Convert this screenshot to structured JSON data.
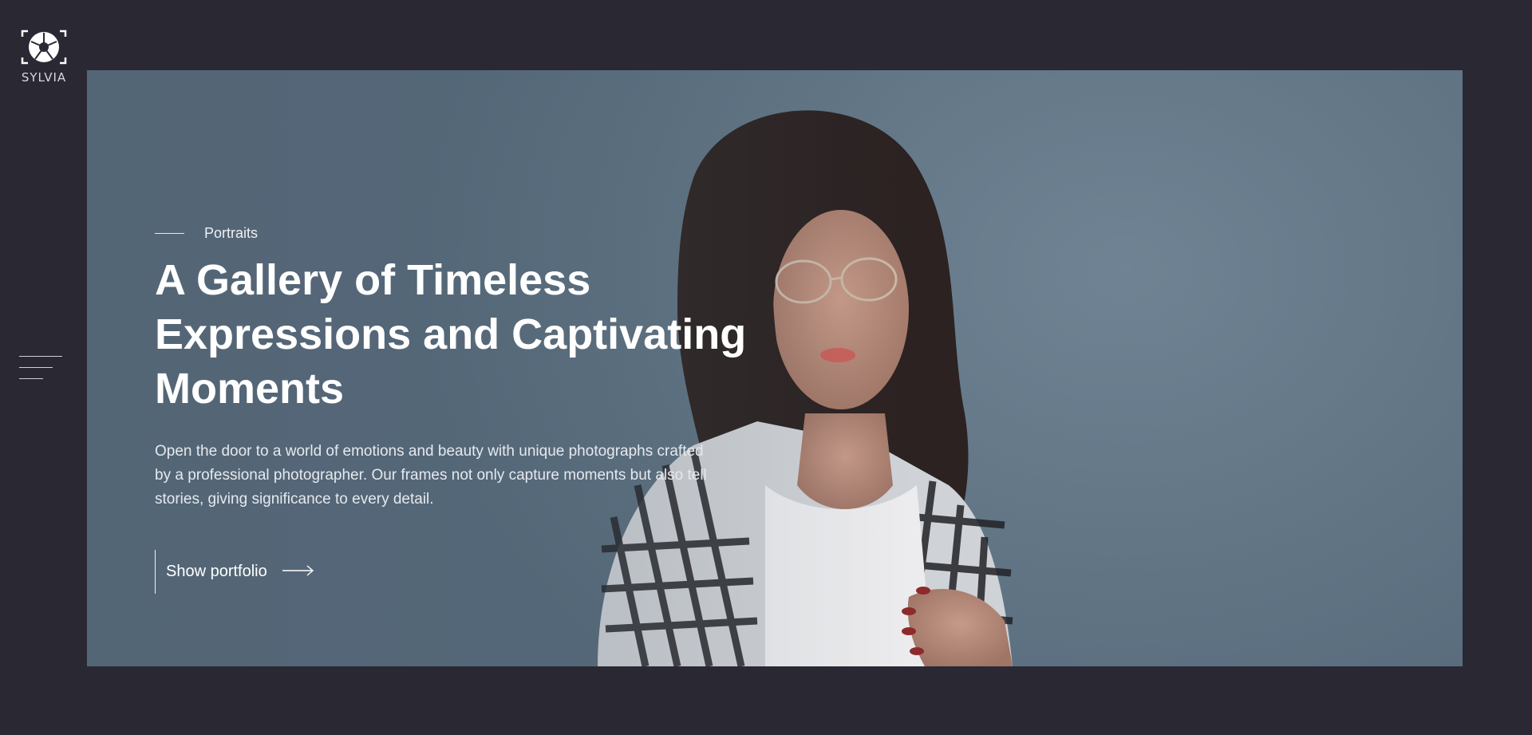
{
  "brand": {
    "name": "SYLVIA",
    "logo_icon": "camera-aperture-icon"
  },
  "menu": {
    "icon": "hamburger-menu-icon"
  },
  "hero": {
    "category": "Portraits",
    "title": "A Gallery of Timeless Expressions and Captivating Moments",
    "description": "Open the door to a world of emotions and beauty with unique photographs crafted by a professional photographer. Our frames not only capture moments but also tell stories, giving significance to every detail.",
    "cta_label": "Show portfolio",
    "cta_icon": "arrow-right-icon"
  },
  "slider": {
    "prev_icon": "chevron-left-icon",
    "next_icon": "chevron-right-icon",
    "progress_fraction": 0.2
  },
  "colors": {
    "background": "#2a2833",
    "hero_sky": "#637787",
    "text": "#ffffff"
  }
}
